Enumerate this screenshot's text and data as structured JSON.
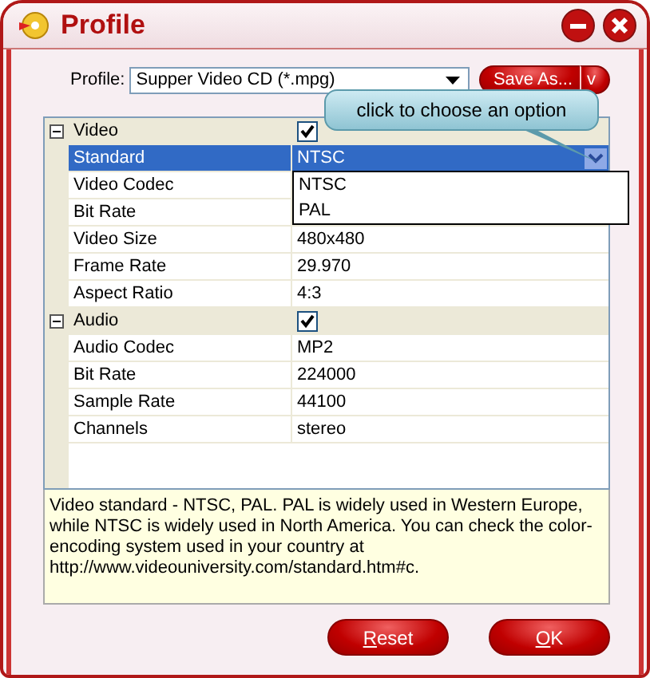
{
  "window": {
    "title": "Profile"
  },
  "profile": {
    "label": "Profile:",
    "value": "Supper Video CD (*.mpg)",
    "save_button": "Save As...",
    "save_menu": "v"
  },
  "tooltip": "click to choose an option",
  "grid": {
    "categories": [
      {
        "name": "Video",
        "expanded": true,
        "checked": true,
        "rows": [
          {
            "name": "Standard",
            "value": "NTSC",
            "selected": true,
            "dropdown": [
              "NTSC",
              "PAL"
            ]
          },
          {
            "name": "Video Codec",
            "selected": false
          },
          {
            "name": "Bit Rate",
            "selected": false
          },
          {
            "name": "Video Size",
            "value": "480x480",
            "selected": false
          },
          {
            "name": "Frame Rate",
            "value": "29.970",
            "selected": false
          },
          {
            "name": "Aspect Ratio",
            "value": "4:3",
            "selected": false
          }
        ]
      },
      {
        "name": "Audio",
        "expanded": true,
        "checked": true,
        "rows": [
          {
            "name": "Audio Codec",
            "value": "MP2",
            "selected": false
          },
          {
            "name": "Bit Rate",
            "value": "224000",
            "selected": false
          },
          {
            "name": "Sample Rate",
            "value": "44100",
            "selected": false
          },
          {
            "name": "Channels",
            "value": "stereo",
            "selected": false
          }
        ]
      }
    ]
  },
  "description": "Video standard - NTSC, PAL. PAL is widely used in Western Europe, while NTSC is widely used in North America. You can check the color-encoding system used in your country at http://www.videouniversity.com/standard.htm#c.",
  "buttons": [
    "Reset",
    "OK"
  ]
}
